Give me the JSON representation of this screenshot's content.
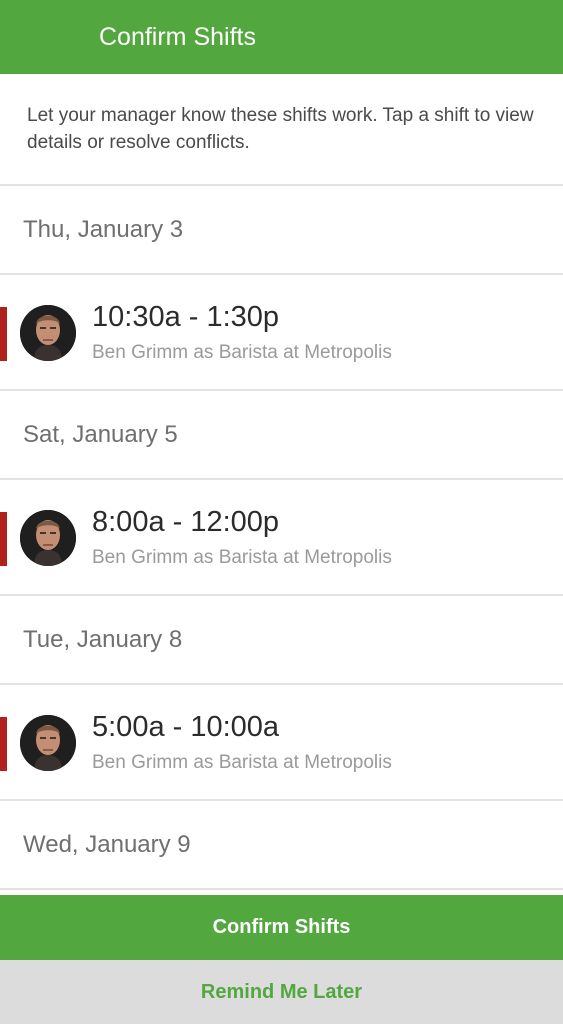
{
  "header": {
    "title": "Confirm Shifts"
  },
  "intro": "Let your manager know these shifts work. Tap a shift to view details or resolve conflicts.",
  "days": [
    {
      "date": "Thu, January 3",
      "shift": {
        "time": "10:30a - 1:30p",
        "detail": "Ben Grimm as Barista at Metropolis"
      }
    },
    {
      "date": "Sat, January 5",
      "shift": {
        "time": "8:00a - 12:00p",
        "detail": "Ben Grimm as Barista at Metropolis"
      }
    },
    {
      "date": "Tue, January 8",
      "shift": {
        "time": "5:00a - 10:00a",
        "detail": "Ben Grimm as Barista at Metropolis"
      }
    },
    {
      "date": "Wed, January 9"
    }
  ],
  "actions": {
    "confirm": "Confirm Shifts",
    "remind": "Remind Me Later"
  },
  "colors": {
    "brand": "#52a73e",
    "conflict": "#b0211c",
    "secondary_bg": "#dcdcdc"
  }
}
